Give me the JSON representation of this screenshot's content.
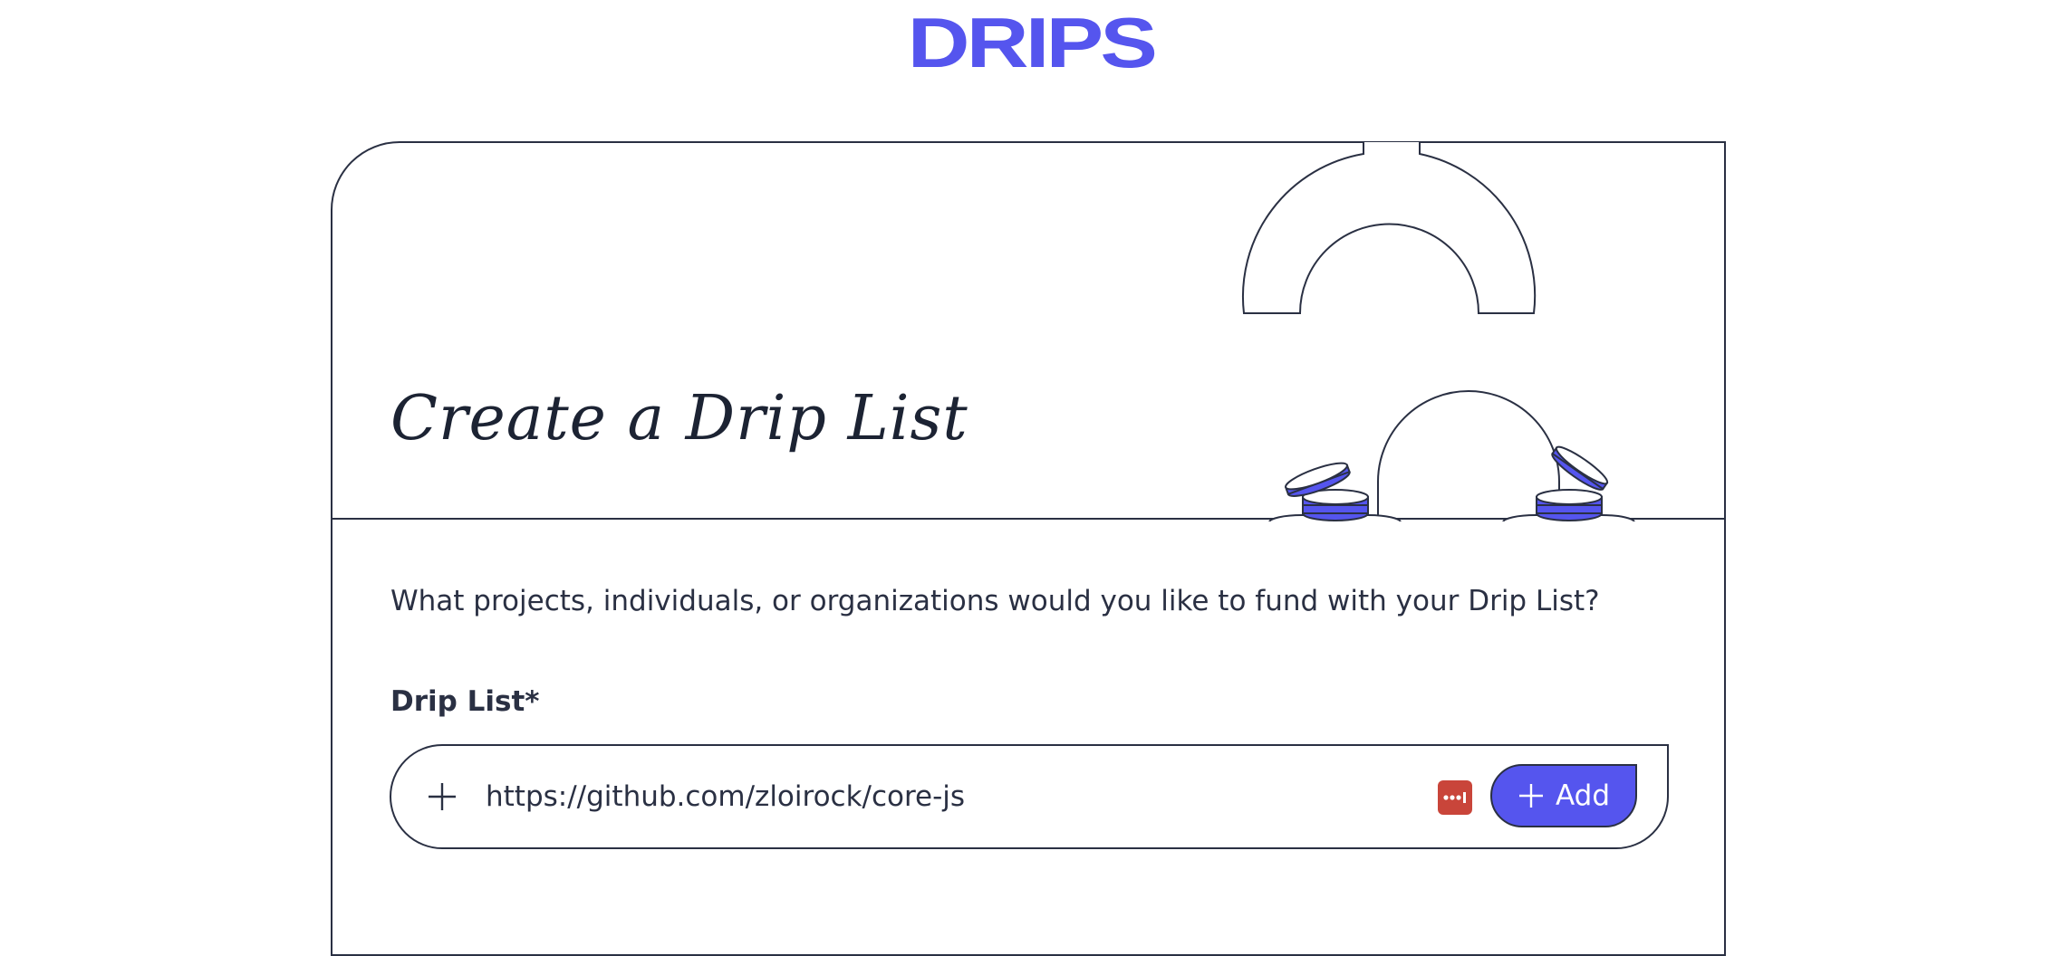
{
  "header": {
    "logo_text": "DRIPS"
  },
  "card": {
    "title": "Create a Drip List",
    "description": "What projects, individuals, or organizations would you like to fund with your Drip List?",
    "field_label": "Drip List*",
    "input": {
      "value": "https://github.com/zloirock/core-js"
    },
    "add_button_label": "Add"
  },
  "icons": {
    "add_input": "plus-icon",
    "password_manager": "password-manager-icon",
    "add_button": "plus-icon"
  },
  "colors": {
    "brand": "#5555ee",
    "ink": "#2a3043",
    "password_manager": "#c9453a"
  }
}
